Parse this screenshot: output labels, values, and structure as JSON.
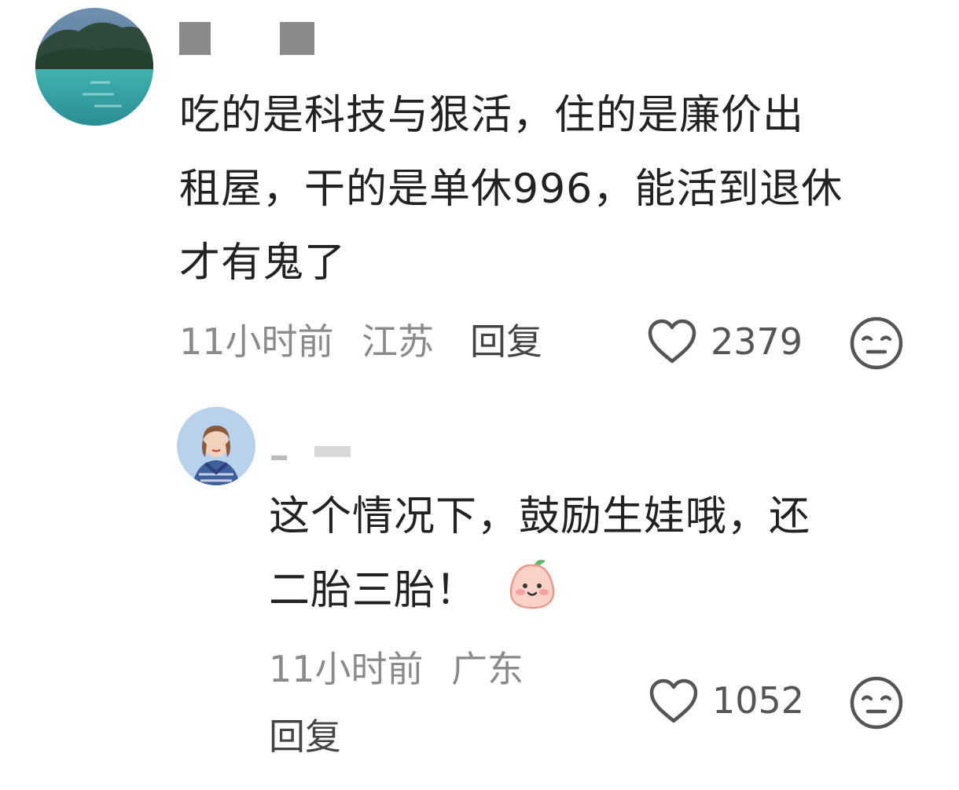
{
  "comments": [
    {
      "avatar_icon": "lake-landscape-avatar",
      "text": "吃的是科技与狠活，住的是廉价出\n租屋，干的是单休996，能活到退休\n才有鬼了",
      "time": "11小时前",
      "location": "江苏",
      "reply_label": "回复",
      "likes": "2379",
      "like_icon": "heart-outline-icon",
      "dislike_icon": "meh-face-icon"
    }
  ],
  "replies": [
    {
      "avatar_icon": "person-portrait-avatar",
      "text": "这个情况下，鼓励生娃哦，还\n二胎三胎！",
      "emoji_icon": "peach-smile-emoji",
      "time": "11小时前",
      "location": "广东",
      "reply_label": "回复",
      "likes": "1052",
      "like_icon": "heart-outline-icon",
      "dislike_icon": "meh-face-icon"
    }
  ],
  "colors": {
    "text": "#222222",
    "meta": "#8a8a8a",
    "icon": "#555555"
  }
}
